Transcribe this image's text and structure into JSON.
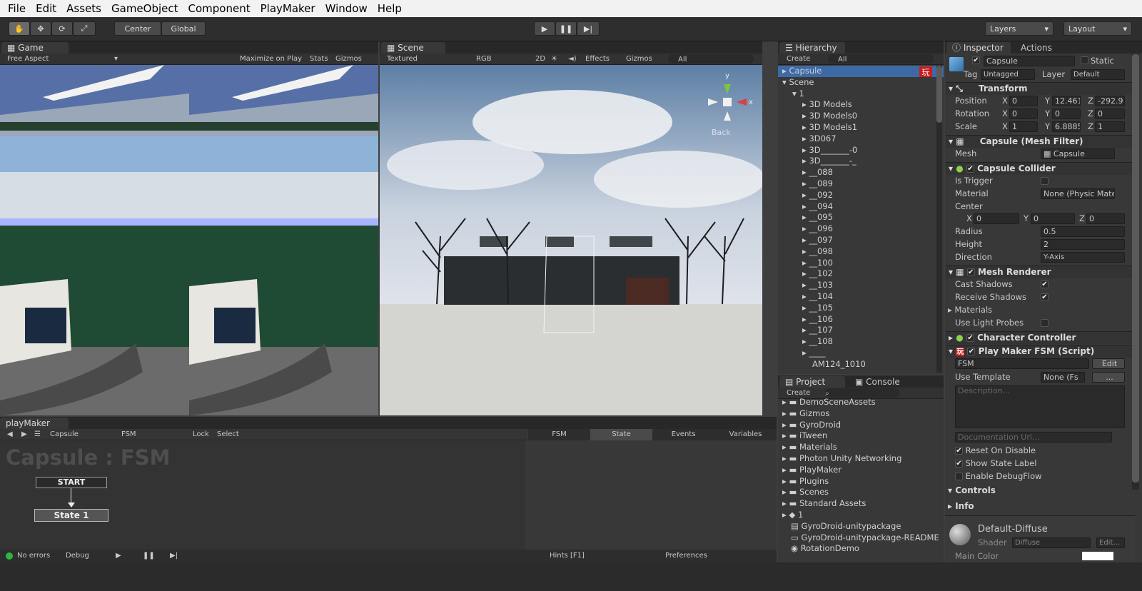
{
  "menu": [
    "File",
    "Edit",
    "Assets",
    "GameObject",
    "Component",
    "PlayMaker",
    "Window",
    "Help"
  ],
  "toolbar": {
    "center": "Center",
    "global": "Global",
    "layers": "Layers",
    "layout": "Layout"
  },
  "game": {
    "tab": "Game",
    "aspect": "Free Aspect",
    "maximize": "Maximize on Play",
    "stats": "Stats",
    "gizmos": "Gizmos"
  },
  "scene": {
    "tab": "Scene",
    "shading": "Textured",
    "rgb": "RGB",
    "mode2d": "2D",
    "effects": "Effects",
    "gizmos": "Gizmos",
    "search": "All",
    "back": "Back",
    "axis_y": "y",
    "axis_x": "x"
  },
  "hierarchy": {
    "tab": "Hierarchy",
    "create": "Create",
    "search": "All",
    "items": [
      "Capsule",
      "Scene",
      "1",
      "3D Models",
      "3D Models0",
      "3D Models1",
      "3D067",
      "3D_______-0",
      "3D_______-_",
      "__088",
      "__089",
      "__092",
      "__094",
      "__095",
      "__096",
      "__097",
      "__098",
      "__100",
      "__102",
      "__103",
      "__104",
      "__105",
      "__106",
      "__107",
      "__108",
      "____",
      "AM124_1010"
    ]
  },
  "project": {
    "tab": "Project",
    "console": "Console",
    "create": "Create",
    "items": [
      "DemoSceneAssets",
      "Gizmos",
      "GyroDroid",
      "iTween",
      "Materials",
      "Photon Unity Networking",
      "PlayMaker",
      "Plugins",
      "Scenes",
      "Standard Assets",
      "1",
      "GyroDroid-unitypackage",
      "GyroDroid-unitypackage-README",
      "RotationDemo"
    ]
  },
  "inspector": {
    "tab": "Inspector",
    "actions": "Actions",
    "name": "Capsule",
    "static": "Static",
    "tag_label": "Tag",
    "tag": "Untagged",
    "layer_label": "Layer",
    "layer": "Default",
    "transform": {
      "title": "Transform",
      "position": "Position",
      "rotation": "Rotation",
      "scale": "Scale",
      "px": "0",
      "py": "12.461",
      "pz": "-292.9",
      "rx": "0",
      "ry": "0",
      "rz": "0",
      "sx": "1",
      "sy": "6.8885",
      "sz": "1"
    },
    "meshfilter": {
      "title": "Capsule (Mesh Filter)",
      "mesh_label": "Mesh",
      "mesh": "Capsule"
    },
    "collider": {
      "title": "Capsule Collider",
      "trigger": "Is Trigger",
      "material": "Material",
      "material_val": "None (Physic Mate",
      "center": "Center",
      "cx": "0",
      "cy": "0",
      "cz": "0",
      "radius": "Radius",
      "radius_val": "0.5",
      "height": "Height",
      "height_val": "2",
      "direction": "Direction",
      "direction_val": "Y-Axis"
    },
    "renderer": {
      "title": "Mesh Renderer",
      "cast": "Cast Shadows",
      "receive": "Receive Shadows",
      "materials": "Materials",
      "probes": "Use Light Probes"
    },
    "charctrl": {
      "title": "Character Controller"
    },
    "fsm": {
      "title": "Play Maker FSM (Script)",
      "name": "FSM",
      "edit": "Edit",
      "template": "Use Template",
      "template_val": "None (Fs",
      "desc": "Description...",
      "doc": "Documentation Url...",
      "reset": "Reset On Disable",
      "show": "Show State Label",
      "debug": "Enable DebugFlow",
      "controls": "Controls",
      "info": "Info"
    },
    "material": {
      "name": "Default-Diffuse",
      "shader_label": "Shader",
      "shader": "Diffuse",
      "edit": "Edit...",
      "main_color": "Main Color"
    }
  },
  "playmaker": {
    "tab": "playMaker",
    "target": "Capsule",
    "fsm": "FSM",
    "lock": "Lock",
    "select": "Select",
    "title": "Capsule : FSM",
    "start": "START",
    "state1": "State 1",
    "tabs": [
      "FSM",
      "State",
      "Events",
      "Variables"
    ],
    "errors": "No errors",
    "debug": "Debug",
    "hints": "Hints [F1]",
    "prefs": "Preferences"
  }
}
